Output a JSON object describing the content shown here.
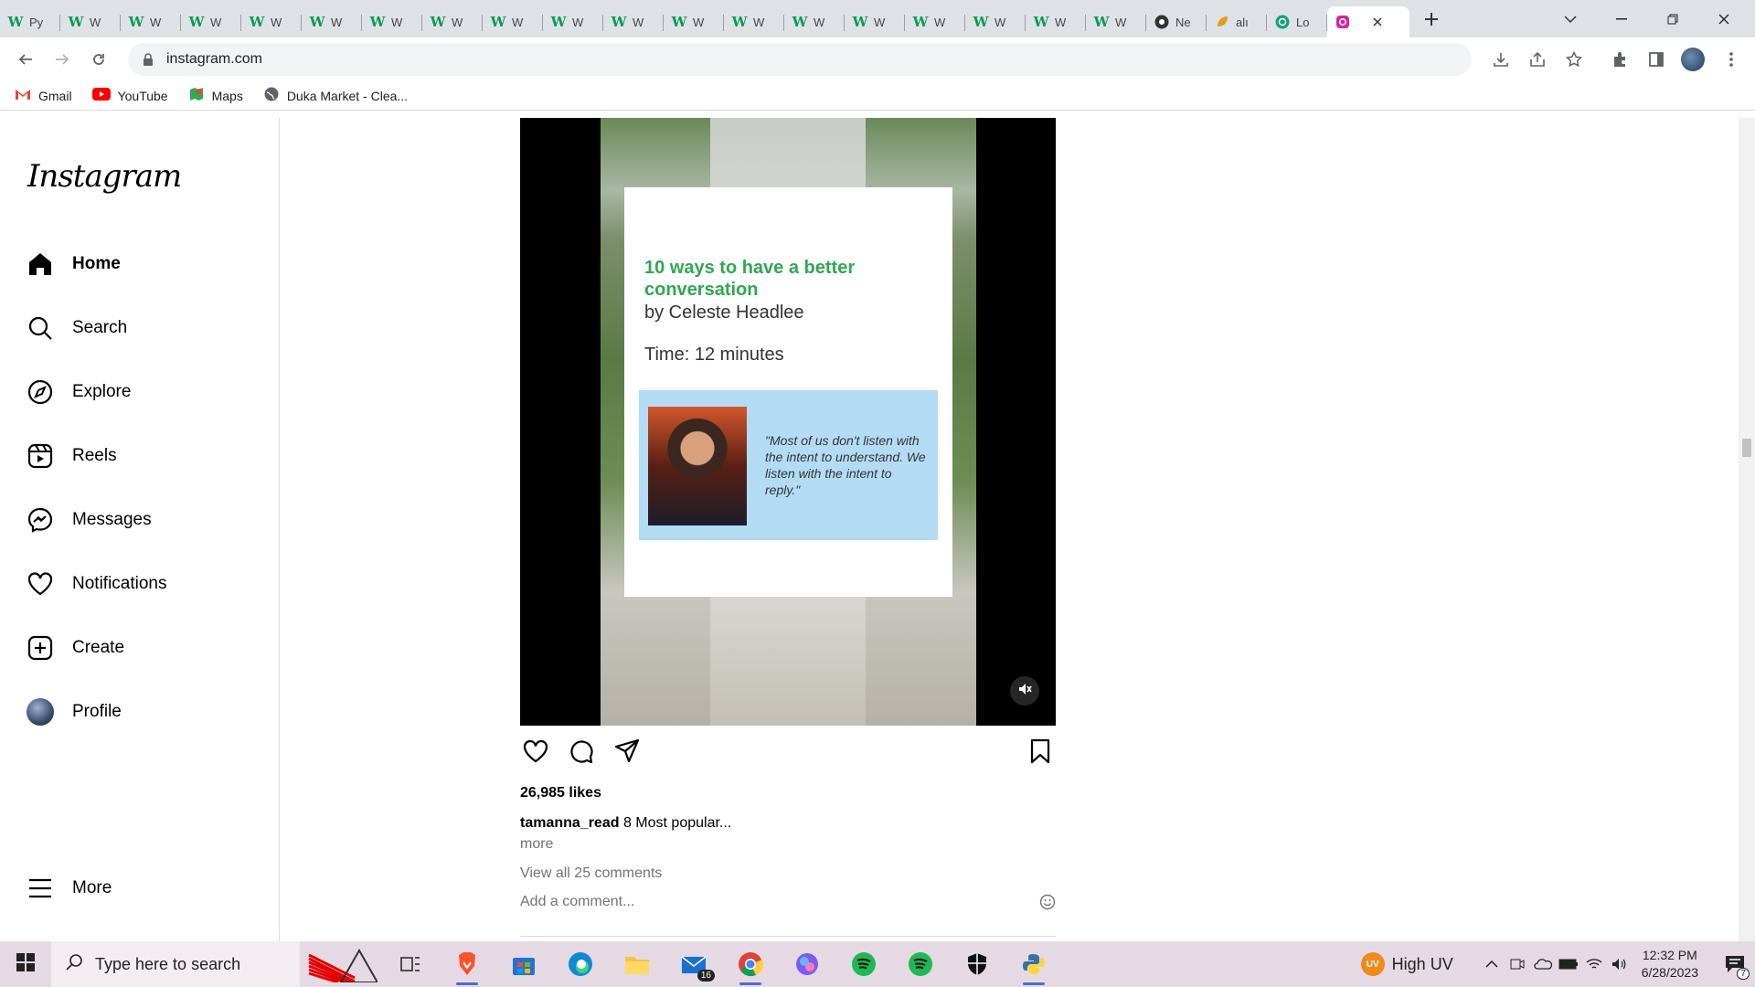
{
  "browser": {
    "tabs": [
      {
        "icon": "W",
        "label": "Py"
      },
      {
        "icon": "W",
        "label": "W"
      },
      {
        "icon": "W",
        "label": "W"
      },
      {
        "icon": "W",
        "label": "W"
      },
      {
        "icon": "W",
        "label": "W"
      },
      {
        "icon": "W",
        "label": "W"
      },
      {
        "icon": "W",
        "label": "W"
      },
      {
        "icon": "W",
        "label": "W"
      },
      {
        "icon": "W",
        "label": "W"
      },
      {
        "icon": "W",
        "label": "W"
      },
      {
        "icon": "W",
        "label": "W"
      },
      {
        "icon": "W",
        "label": "W"
      },
      {
        "icon": "W",
        "label": "W"
      },
      {
        "icon": "W",
        "label": "W"
      },
      {
        "icon": "W",
        "label": "W"
      },
      {
        "icon": "W",
        "label": "W"
      },
      {
        "icon": "W",
        "label": "W"
      },
      {
        "icon": "W",
        "label": "W"
      },
      {
        "icon": "W",
        "label": "W"
      },
      {
        "icon": "github",
        "label": "Ne"
      },
      {
        "icon": "leaf",
        "label": "alı"
      },
      {
        "icon": "openai",
        "label": "Lo"
      },
      {
        "icon": "instagram",
        "label": "",
        "active": true
      }
    ],
    "url": "instagram.com",
    "bookmarks": [
      {
        "icon": "gmail-icon",
        "label": "Gmail"
      },
      {
        "icon": "youtube-icon",
        "label": "YouTube"
      },
      {
        "icon": "maps-icon",
        "label": "Maps"
      },
      {
        "icon": "globe-icon",
        "label": "Duka Market - Clea..."
      }
    ]
  },
  "sidebar": {
    "logo": "Instagram",
    "items": [
      {
        "icon": "home-icon",
        "label": "Home"
      },
      {
        "icon": "search-icon",
        "label": "Search"
      },
      {
        "icon": "explore-icon",
        "label": "Explore"
      },
      {
        "icon": "reels-icon",
        "label": "Reels"
      },
      {
        "icon": "messages-icon",
        "label": "Messages"
      },
      {
        "icon": "heart-icon",
        "label": "Notifications"
      },
      {
        "icon": "create-icon",
        "label": "Create"
      },
      {
        "icon": "avatar",
        "label": "Profile"
      }
    ],
    "more": "More"
  },
  "post": {
    "card_title": "10 ways to have a better conversation",
    "card_author": "by Celeste Headlee",
    "card_time": "Time: 12 minutes",
    "quote": "\"Most of us don't listen with the intent to understand. We listen with the intent to reply.\"",
    "likes": "26,985 likes",
    "username": "tamanna_read",
    "caption": "8 Most popular...",
    "more": "more",
    "view_comments": "View all 25 comments",
    "comment_placeholder": "Add a comment..."
  },
  "taskbar": {
    "search_placeholder": "Type here to search",
    "weather": "High UV",
    "weather_badge": "UV",
    "time": "12:32 PM",
    "date": "6/28/2023",
    "mail_badge": "16",
    "notif_badge": "7"
  }
}
